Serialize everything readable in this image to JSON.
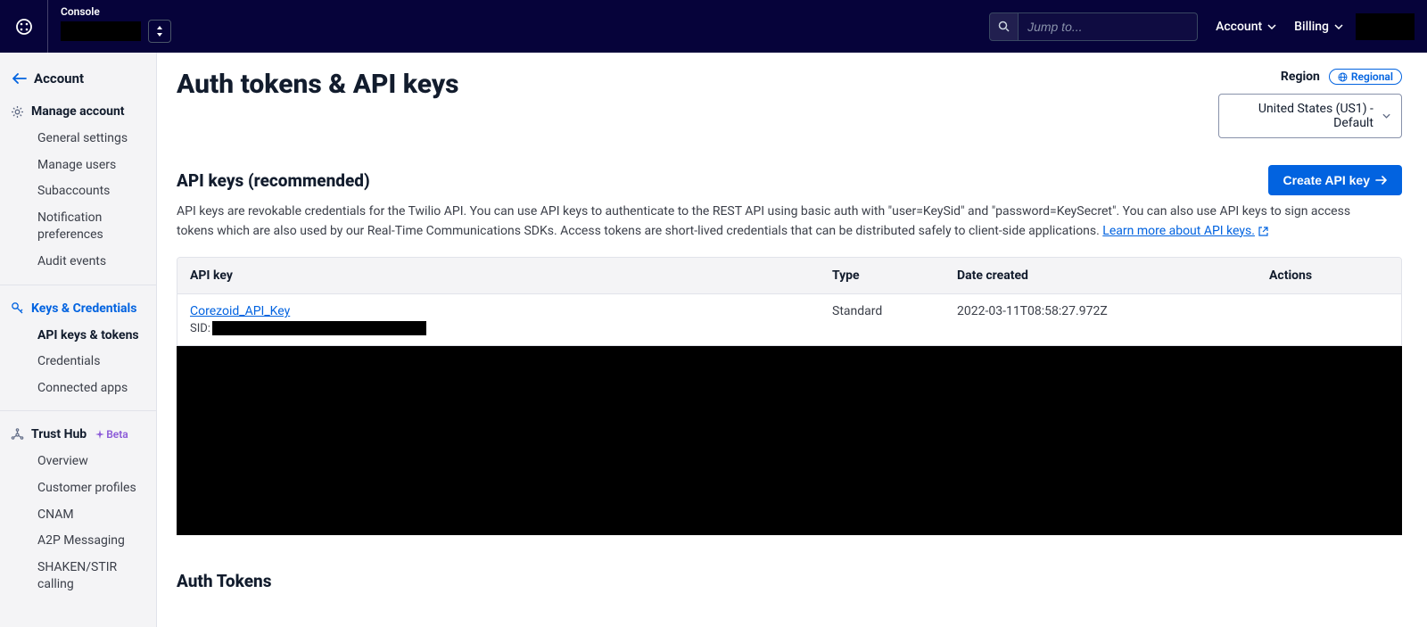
{
  "topnav": {
    "console_label": "Console",
    "search_placeholder": "Jump to...",
    "account": "Account",
    "billing": "Billing"
  },
  "sidebar": {
    "back_label": "Account",
    "sections": [
      {
        "title": "Manage account",
        "icon": "gear",
        "items": [
          {
            "label": "General settings",
            "active": false
          },
          {
            "label": "Manage users",
            "active": false
          },
          {
            "label": "Subaccounts",
            "active": false
          },
          {
            "label": "Notification preferences",
            "active": false
          },
          {
            "label": "Audit events",
            "active": false
          }
        ]
      },
      {
        "title": "Keys & Credentials",
        "icon": "key",
        "items": [
          {
            "label": "API keys & tokens",
            "active": true
          },
          {
            "label": "Credentials",
            "active": false
          },
          {
            "label": "Connected apps",
            "active": false
          }
        ]
      },
      {
        "title": "Trust Hub",
        "icon": "hub",
        "badge": "Beta",
        "items": [
          {
            "label": "Overview",
            "active": false
          },
          {
            "label": "Customer profiles",
            "active": false
          },
          {
            "label": "CNAM",
            "active": false
          },
          {
            "label": "A2P Messaging",
            "active": false
          },
          {
            "label": "SHAKEN/STIR calling",
            "active": false
          }
        ]
      }
    ]
  },
  "page": {
    "title": "Auth tokens & API keys",
    "region_label": "Region",
    "regional_badge": "Regional",
    "region_selected": "United States (US1) - Default",
    "section1_title": "API keys (recommended)",
    "create_btn": "Create API key",
    "desc_part1": "API keys are revokable credentials for the Twilio API. You can use API keys to authenticate to the REST API using basic auth with \"user=KeySid\" and \"password=KeySecret\". You can also use API keys to sign access tokens which are also used by our Real-Time Communications SDKs. Access tokens are short-lived credentials that can be distributed safely to client-side applications. ",
    "learn_more": "Learn more about API keys.",
    "table": {
      "headers": {
        "key": "API key",
        "type": "Type",
        "date": "Date created",
        "actions": "Actions"
      },
      "row": {
        "name": "Corezoid_API_Key",
        "sid_prefix": "SID:",
        "type": "Standard",
        "date": "2022-03-11T08:58:27.972Z"
      }
    },
    "section2_title": "Auth Tokens"
  }
}
